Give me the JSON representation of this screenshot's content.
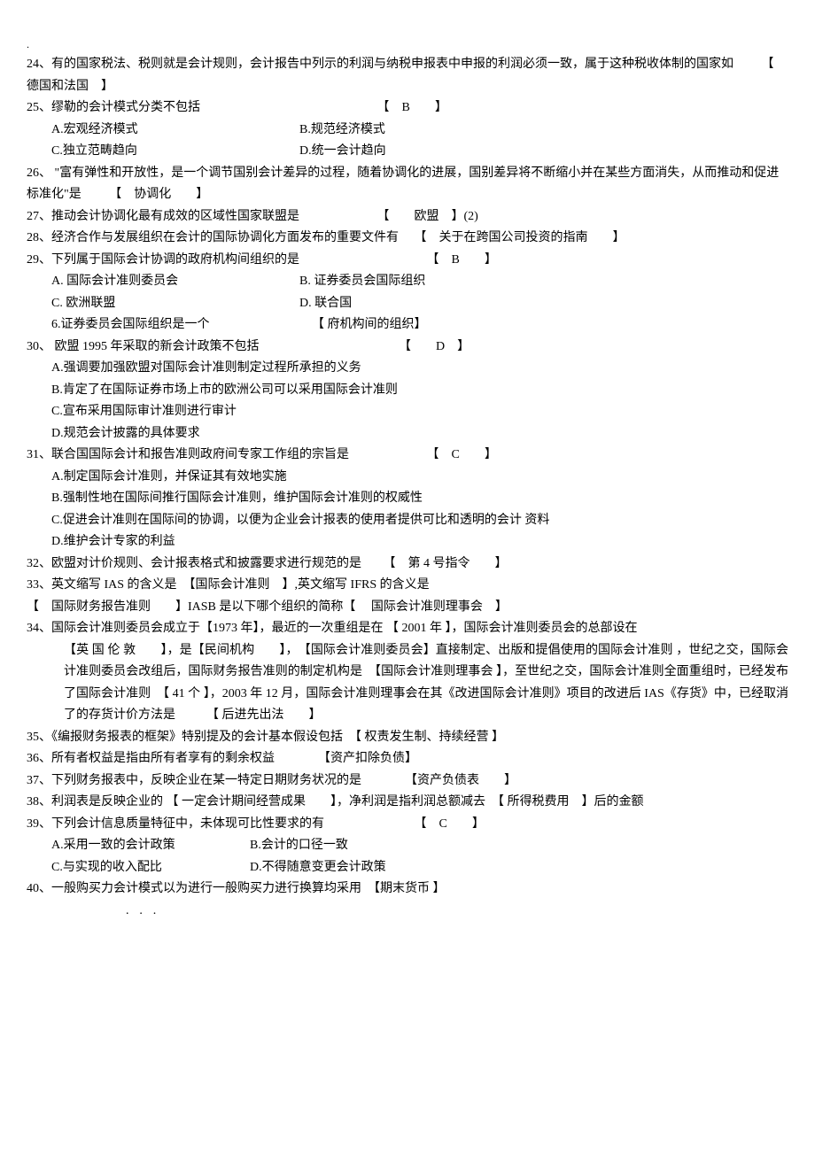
{
  "topdot": ".",
  "q24": {
    "text": "24、有的国家税法、税则就是会计规则，会计报告中列示的利润与纳税申报表中申报的利润必须一致，属于这种税收体制的国家如",
    "ans": "德国和法国"
  },
  "q25": {
    "text": "25、缪勒的会计模式分类不包括",
    "ans": "B",
    "a": "A.宏观经济模式",
    "b": "B.规范经济模式",
    "c": "C.独立范畴趋向",
    "d": "D.统一会计趋向"
  },
  "q26": {
    "text": "26、 \"富有弹性和开放性，是一个调节国别会计差异的过程，随着协调化的进展，国别差异将不断缩小并在某些方面消失，从而推动和促进标准化\"是",
    "ans": "协调化"
  },
  "q27": {
    "text": "27、推动会计协调化最有成效的区域性国家联盟是",
    "ans": "欧盟",
    "tail": "(2)"
  },
  "q28": {
    "text": "28、经济合作与发展组织在会计的国际协调化方面发布的重要文件有",
    "ans": "关于在跨国公司投资的指南"
  },
  "q29": {
    "text": "29、下列属于国际会计协调的政府机构间组织的是",
    "ans": "B",
    "a": "A. 国际会计准则委员会",
    "b": "B. 证券委员会国际组织",
    "c": "C. 欧洲联盟",
    "d": "D. 联合国",
    "sub": "6.证券委员会国际组织是一个",
    "subans": "府机构间的组织"
  },
  "q30": {
    "text": "30、 欧盟 1995 年采取的新会计政策不包括",
    "ans": "D",
    "a": "A.强调要加强欧盟对国际会计准则制定过程所承担的义务",
    "b": "B.肯定了在国际证券市场上市的欧洲公司可以采用国际会计准则",
    "c": "C.宣布采用国际审计准则进行审计",
    "d": "D.规范会计披露的具体要求"
  },
  "q31": {
    "text": "31、联合国国际会计和报告准则政府间专家工作组的宗旨是",
    "ans": "C",
    "a": "A.制定国际会计准则，并保证其有效地实施",
    "b": "B.强制性地在国际间推行国际会计准则，维护国际会计准则的权威性",
    "c": "C.促进会计准则在国际间的协调，以便为企业会计报表的使用者提供可比和透明的会计 资料",
    "d": "D.维护会计专家的利益"
  },
  "q32": {
    "text": "32、欧盟对计价规则、会计报表格式和披露要求进行规范的是",
    "ans": "第 4 号指令"
  },
  "q33": {
    "p1": "33、英文缩写 IAS 的含义是　【国际会计准则　】,英文缩写 IFRS 的含义是",
    "p2": "【　国际财务报告准则　　】IASB 是以下哪个组织的简称【　 国际会计准则理事会　】"
  },
  "q34": {
    "p1": "34、国际会计准则委员会成立于【1973 年】，最近的一次重组是在 【 2001 年 】，国际会计准则委员会的总部设在",
    "p2": "【英 国 伦 敦　　】，是【民间机构　　】，　【国际会计准则委员会】直接制定、出版和提倡使用的国际会计准则 ，世纪之交，国际会计准则委员会改组后，国际财务报告准则的制定机构是　【国际会计准则理事会 】，至世纪之交，国际会计准则全面重组时，已经发布了国际会计准则　【 41 个 】，2003 年 12 月，国际会计准则理事会在其《改进国际会计准则》项目的改进后 IAS《存货》中，已经取消了的存货计价方法是　　　【 后进先出法　　】"
  },
  "q35": {
    "text": "35、《编报财务报表的框架》特别提及的会计基本假设包括　【 权责发生制、持续经营 】"
  },
  "q36": {
    "text": "36、所有者权益是指由所有者享有的剩余权益　　　　【资产扣除负债】"
  },
  "q37": {
    "text": "37、下列财务报表中，反映企业在某一特定日期财务状况的是　　　　【资产负债表　　】"
  },
  "q38": {
    "text": "38、利润表是反映企业的 【 一定会计期间经营成果　　】，净利润是指利润总额减去　【 所得税费用　】后的金额"
  },
  "q39": {
    "text": "39、下列会计信息质量特征中，未体现可比性要求的有",
    "ans": "C",
    "a": "A.采用一致的会计政策",
    "b": "B.会计的口径一致",
    "c": "C.与实现的收入配比",
    "d": "D.不得随意变更会计政策"
  },
  "q40": {
    "text": "40、一般购买力会计模式以为进行一般购买力进行换算均采用　【期末货币 】"
  },
  "bottomdots": ". . ."
}
